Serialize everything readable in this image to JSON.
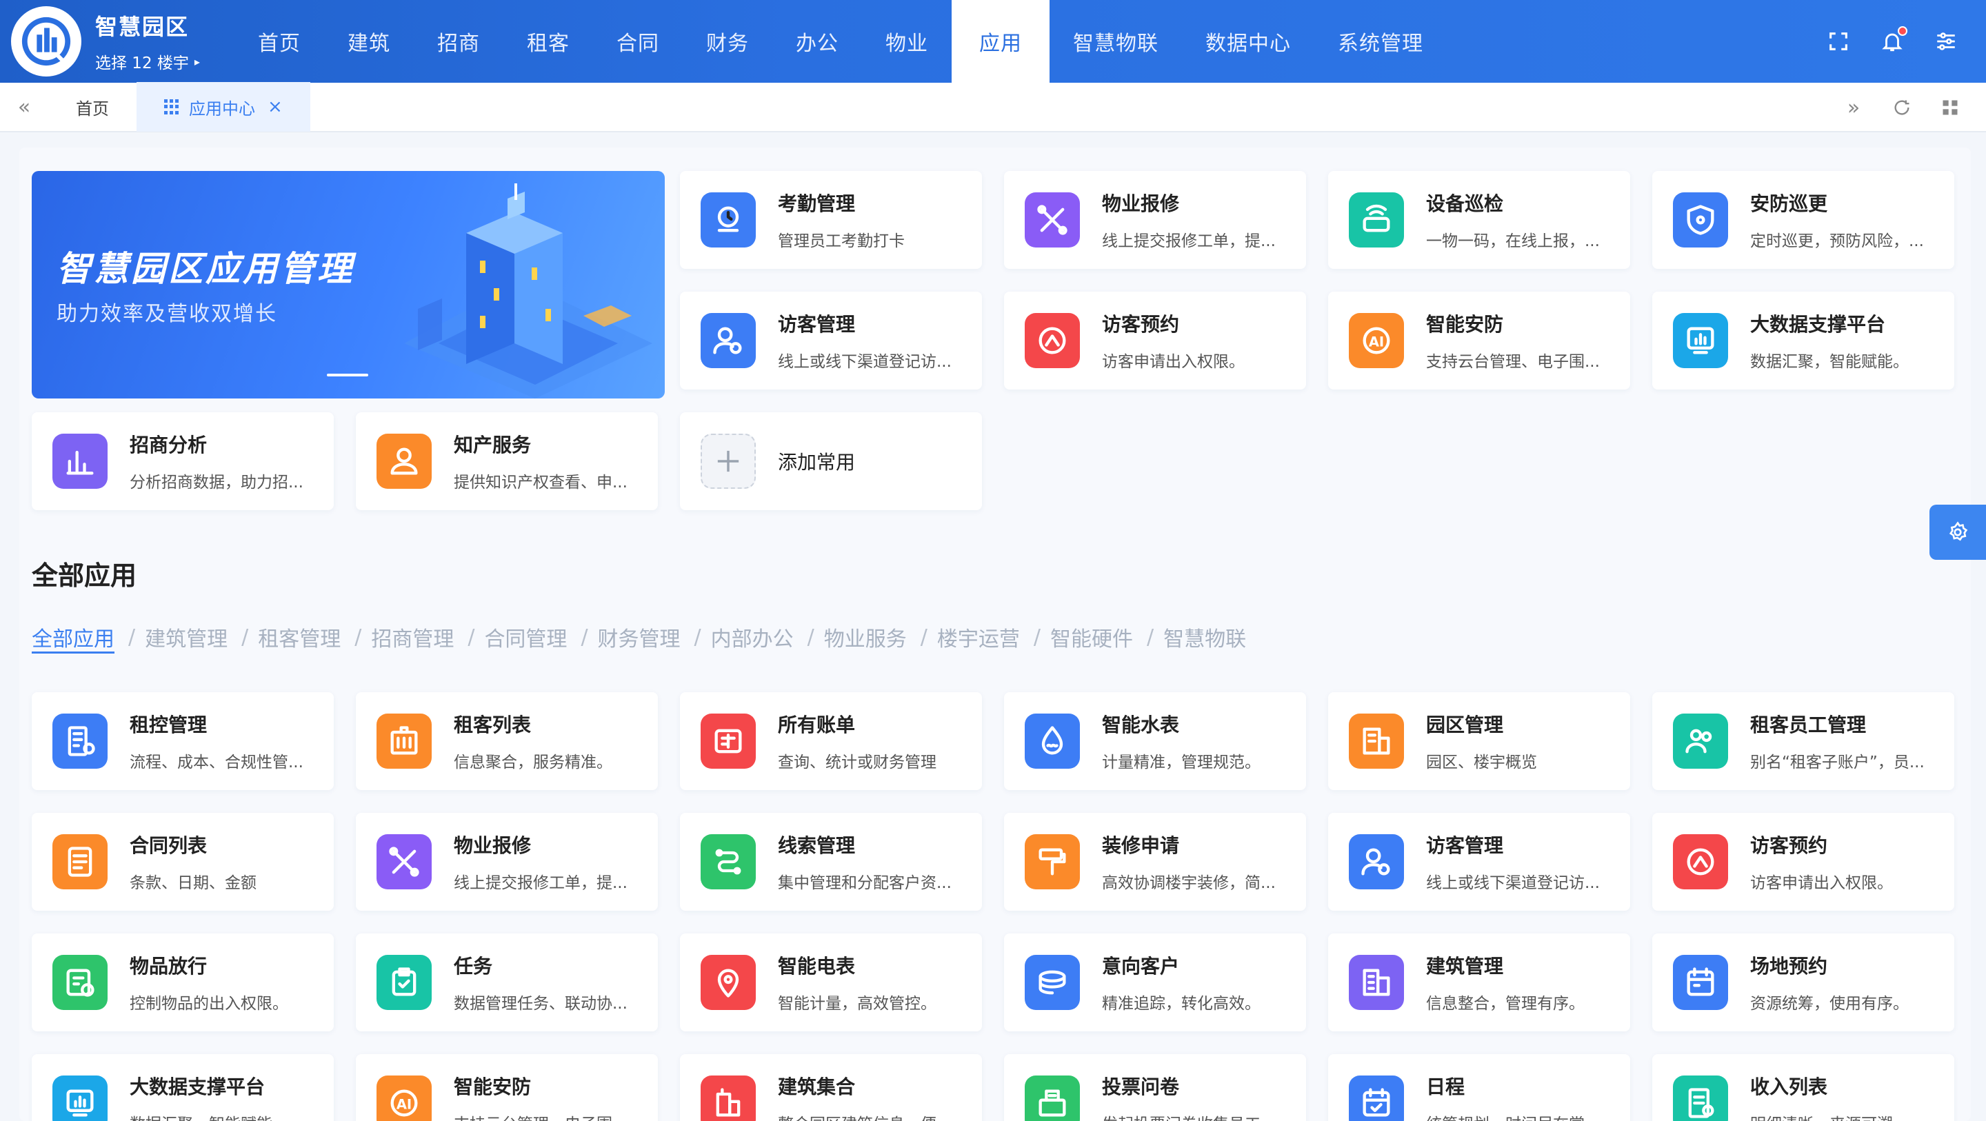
{
  "brand": {
    "title": "智慧园区",
    "subtitle": "选择 12 楼宇",
    "caret": "▸"
  },
  "nav": [
    "首页",
    "建筑",
    "招商",
    "租客",
    "合同",
    "财务",
    "办公",
    "物业",
    "应用",
    "智慧物联",
    "数据中心",
    "系统管理"
  ],
  "nav_active_index": 8,
  "tabs": {
    "home": "首页",
    "current": "应用中心",
    "close": "×"
  },
  "banner": {
    "title": "智慧园区应用管理",
    "subtitle": "助力效率及营收双增长"
  },
  "favorites": [
    {
      "title": "考勤管理",
      "desc": "管理员工考勤打卡",
      "icon": "attendance-icon",
      "color": "#3d7df5"
    },
    {
      "title": "物业报修",
      "desc": "线上提交报修工单，提...",
      "icon": "repair-icon",
      "color": "#8a5cf6"
    },
    {
      "title": "设备巡检",
      "desc": "一物一码，在线上报，...",
      "icon": "device-inspection-icon",
      "color": "#18c4a6"
    },
    {
      "title": "安防巡更",
      "desc": "定时巡更，预防风险，...",
      "icon": "security-patrol-icon",
      "color": "#3d7df5"
    },
    {
      "title": "访客管理",
      "desc": "线上或线下渠道登记访...",
      "icon": "visitor-icon",
      "color": "#3d7df5"
    },
    {
      "title": "访客预约",
      "desc": "访客申请出入权限。",
      "icon": "visitor-booking-icon",
      "color": "#f4474a"
    },
    {
      "title": "智能安防",
      "desc": "支持云台管理、电子围...",
      "icon": "ai-security-icon",
      "color": "#fb8a2a"
    },
    {
      "title": "大数据支撑平台",
      "desc": "数据汇聚，智能赋能。",
      "icon": "bigdata-icon",
      "color": "#1ba7e8"
    },
    {
      "title": "招商分析",
      "desc": "分析招商数据，助力招...",
      "icon": "bar-chart-icon",
      "color": "#7d63f3"
    },
    {
      "title": "知产服务",
      "desc": "提供知识产权查看、申...",
      "icon": "ip-service-icon",
      "color": "#fb8a2a"
    }
  ],
  "add_label": "添加常用",
  "section_title": "全部应用",
  "filters": [
    "全部应用",
    "建筑管理",
    "租客管理",
    "招商管理",
    "合同管理",
    "财务管理",
    "内部办公",
    "物业服务",
    "楼宇运营",
    "智能硬件",
    "智慧物联"
  ],
  "apps": [
    {
      "title": "租控管理",
      "desc": "流程、成本、合规性管...",
      "icon": "lease-control-icon",
      "color": "#3d7df5"
    },
    {
      "title": "租客列表",
      "desc": "信息聚合，服务精准。",
      "icon": "tenant-list-icon",
      "color": "#fb8a2a"
    },
    {
      "title": "所有账单",
      "desc": "查询、统计或财务管理",
      "icon": "bill-icon",
      "color": "#f4474a"
    },
    {
      "title": "智能水表",
      "desc": "计量精准，管理规范。",
      "icon": "water-meter-icon",
      "color": "#3d7df5"
    },
    {
      "title": "园区管理",
      "desc": "园区、楼宇概览",
      "icon": "park-icon",
      "color": "#fb8a2a"
    },
    {
      "title": "租客员工管理",
      "desc": "别名“租客子账户”，员...",
      "icon": "tenant-staff-icon",
      "color": "#18c4a6"
    },
    {
      "title": "合同列表",
      "desc": "条款、日期、金额",
      "icon": "contract-icon",
      "color": "#fb8a2a"
    },
    {
      "title": "物业报修",
      "desc": "线上提交报修工单，提...",
      "icon": "repair-icon",
      "color": "#8a5cf6"
    },
    {
      "title": "线索管理",
      "desc": "集中管理和分配客户资...",
      "icon": "lead-icon",
      "color": "#2ec46b"
    },
    {
      "title": "装修申请",
      "desc": "高效协调楼宇装修，简...",
      "icon": "paint-roller-icon",
      "color": "#fb8a2a"
    },
    {
      "title": "访客管理",
      "desc": "线上或线下渠道登记访...",
      "icon": "visitor-icon",
      "color": "#3d7df5"
    },
    {
      "title": "访客预约",
      "desc": "访客申请出入权限。",
      "icon": "visitor-booking-icon",
      "color": "#f4474a"
    },
    {
      "title": "物品放行",
      "desc": "控制物品的出入权限。",
      "icon": "item-release-icon",
      "color": "#2ec46b"
    },
    {
      "title": "任务",
      "desc": "数据管理任务、联动协...",
      "icon": "task-icon",
      "color": "#18c4a6"
    },
    {
      "title": "智能电表",
      "desc": "智能计量，高效管控。",
      "icon": "electric-meter-icon",
      "color": "#f4474a"
    },
    {
      "title": "意向客户",
      "desc": "精准追踪，转化高效。",
      "icon": "prospect-icon",
      "color": "#3d7df5"
    },
    {
      "title": "建筑管理",
      "desc": "信息整合，管理有序。",
      "icon": "building-icon",
      "color": "#7d63f3"
    },
    {
      "title": "场地预约",
      "desc": "资源统筹，使用有序。",
      "icon": "venue-booking-icon",
      "color": "#3d7df5"
    },
    {
      "title": "大数据支撑平台",
      "desc": "数据汇聚，智能赋能。",
      "icon": "bigdata-icon",
      "color": "#1ba7e8"
    },
    {
      "title": "智能安防",
      "desc": "支持云台管理、电子围...",
      "icon": "ai-security-icon",
      "color": "#fb8a2a"
    },
    {
      "title": "建筑集合",
      "desc": "整合园区建筑信息，便...",
      "icon": "building-set-icon",
      "color": "#f4474a"
    },
    {
      "title": "投票问卷",
      "desc": "发起投票问卷收集员工...",
      "icon": "vote-icon",
      "color": "#2ec46b"
    },
    {
      "title": "日程",
      "desc": "统筹规划，时间尽在掌...",
      "icon": "calendar-icon",
      "color": "#3d7df5"
    },
    {
      "title": "收入列表",
      "desc": "明细清晰，来源可溯。",
      "icon": "income-icon",
      "color": "#18c4a6"
    }
  ]
}
